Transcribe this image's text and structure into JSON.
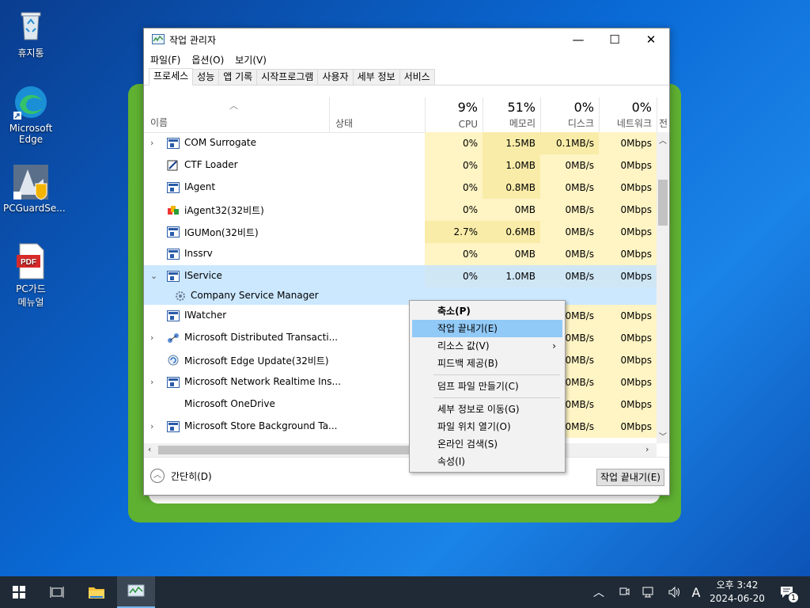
{
  "desktop": {
    "icons": [
      {
        "label": "휴지통"
      },
      {
        "label": "Microsoft Edge"
      },
      {
        "label": "PCGuardSe..."
      },
      {
        "label": "PC가드 메뉴얼"
      }
    ],
    "pdf_badge": "PDF"
  },
  "window": {
    "title": "작업 관리자",
    "controls": {
      "minimize": "—",
      "maximize": "☐",
      "close": "✕"
    },
    "menu": [
      "파일(F)",
      "옵션(O)",
      "보기(V)"
    ],
    "tabs": [
      "프로세스",
      "성능",
      "앱 기록",
      "시작프로그램",
      "사용자",
      "세부 정보",
      "서비스"
    ],
    "active_tab": "프로세스",
    "columns": {
      "name": "이름",
      "status": "상태",
      "cpu": {
        "pct": "9%",
        "label": "CPU"
      },
      "memory": {
        "pct": "51%",
        "label": "메모리"
      },
      "disk": {
        "pct": "0%",
        "label": "디스크"
      },
      "network": {
        "pct": "0%",
        "label": "네트워크"
      },
      "power": "전"
    },
    "rows": [
      {
        "name": "COM Surrogate",
        "cpu": "0%",
        "mem": "1.5MB",
        "disk": "0.1MB/s",
        "net": "0Mbps"
      },
      {
        "name": "CTF Loader",
        "cpu": "0%",
        "mem": "1.0MB",
        "disk": "0MB/s",
        "net": "0Mbps"
      },
      {
        "name": "IAgent",
        "cpu": "0%",
        "mem": "0.8MB",
        "disk": "0MB/s",
        "net": "0Mbps"
      },
      {
        "name": "iAgent32(32비트)",
        "cpu": "0%",
        "mem": "0MB",
        "disk": "0MB/s",
        "net": "0Mbps"
      },
      {
        "name": "IGUMon(32비트)",
        "cpu": "2.7%",
        "mem": "0.6MB",
        "disk": "0MB/s",
        "net": "0Mbps"
      },
      {
        "name": "Inssrv",
        "cpu": "0%",
        "mem": "0MB",
        "disk": "0MB/s",
        "net": "0Mbps"
      },
      {
        "name": "IService",
        "cpu": "0%",
        "mem": "1.0MB",
        "disk": "0MB/s",
        "net": "0Mbps"
      },
      {
        "name": "Company Service Manager"
      },
      {
        "name": "IWatcher",
        "disk": "0MB/s",
        "net": "0Mbps"
      },
      {
        "name": "Microsoft Distributed Transacti...",
        "disk": "0MB/s",
        "net": "0Mbps"
      },
      {
        "name": "Microsoft Edge Update(32비트)",
        "disk": "0MB/s",
        "net": "0Mbps"
      },
      {
        "name": "Microsoft Network Realtime Ins...",
        "disk": "0MB/s",
        "net": "0Mbps"
      },
      {
        "name": "Microsoft OneDrive",
        "disk": "0MB/s",
        "net": "0Mbps"
      },
      {
        "name": "Microsoft Store Background Ta...",
        "disk": "0MB/s",
        "net": "0Mbps"
      }
    ],
    "footer": {
      "fewer_details": "간단히(D)",
      "end_task": "작업 끝내기(E)"
    }
  },
  "context_menu": {
    "items": [
      "축소(P)",
      "작업 끝내기(E)",
      "리소스 값(V)",
      "피드백 제공(B)",
      "덤프 파일 만들기(C)",
      "세부 정보로 이동(G)",
      "파일 위치 열기(O)",
      "온라인 검색(S)",
      "속성(I)"
    ],
    "highlighted": "작업 끝내기(E)",
    "submenu_arrow": "›"
  },
  "taskbar": {
    "ime": "A",
    "time": "오후 3:42",
    "date": "2024-06-20",
    "notification_count": "1"
  },
  "colors": {
    "selection": "#cce8ff",
    "cpu_heat": "#fff4c4",
    "mem_heat": "#f9eca8",
    "taskbar": "#1f2a36",
    "green_panel": "#5fb132"
  }
}
